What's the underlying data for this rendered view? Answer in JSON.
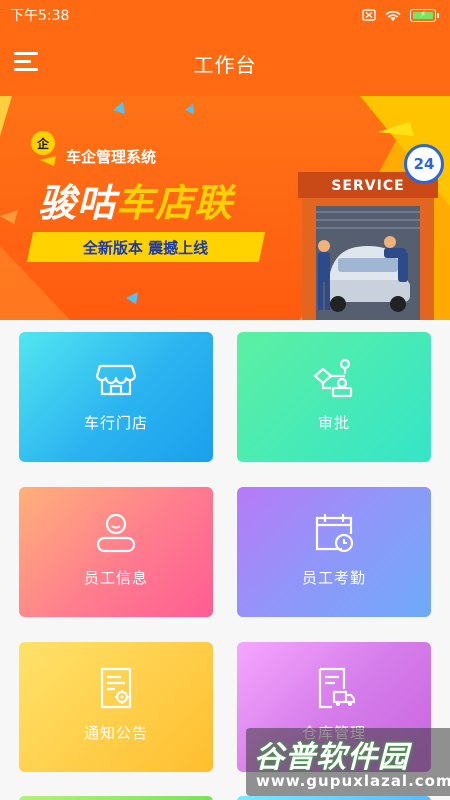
{
  "status_bar": {
    "time": "下午5:38",
    "battery_level": "100"
  },
  "app_bar": {
    "title": "工作台"
  },
  "banner": {
    "logo_glyph": "企",
    "system_name": "车企管理系统",
    "headline_part1": "骏咕",
    "headline_part2": "车店联",
    "slogan": "全新版本 震撼上线",
    "service_sign": "SERVICE",
    "badge": "24"
  },
  "tiles": [
    {
      "label": "车行门店",
      "icon": "store-icon"
    },
    {
      "label": "审批",
      "icon": "approval-flow-icon"
    },
    {
      "label": "员工信息",
      "icon": "person-icon"
    },
    {
      "label": "员工考勤",
      "icon": "calendar-clock-icon"
    },
    {
      "label": "通知公告",
      "icon": "document-gear-icon"
    },
    {
      "label": "仓库管理",
      "icon": "warehouse-truck-icon"
    }
  ],
  "watermark": {
    "title": "谷普软件园",
    "url": "www.gupuxlazal.com"
  },
  "colors": {
    "accent": "#ff6a13",
    "banner_yellow": "#ffd200"
  }
}
